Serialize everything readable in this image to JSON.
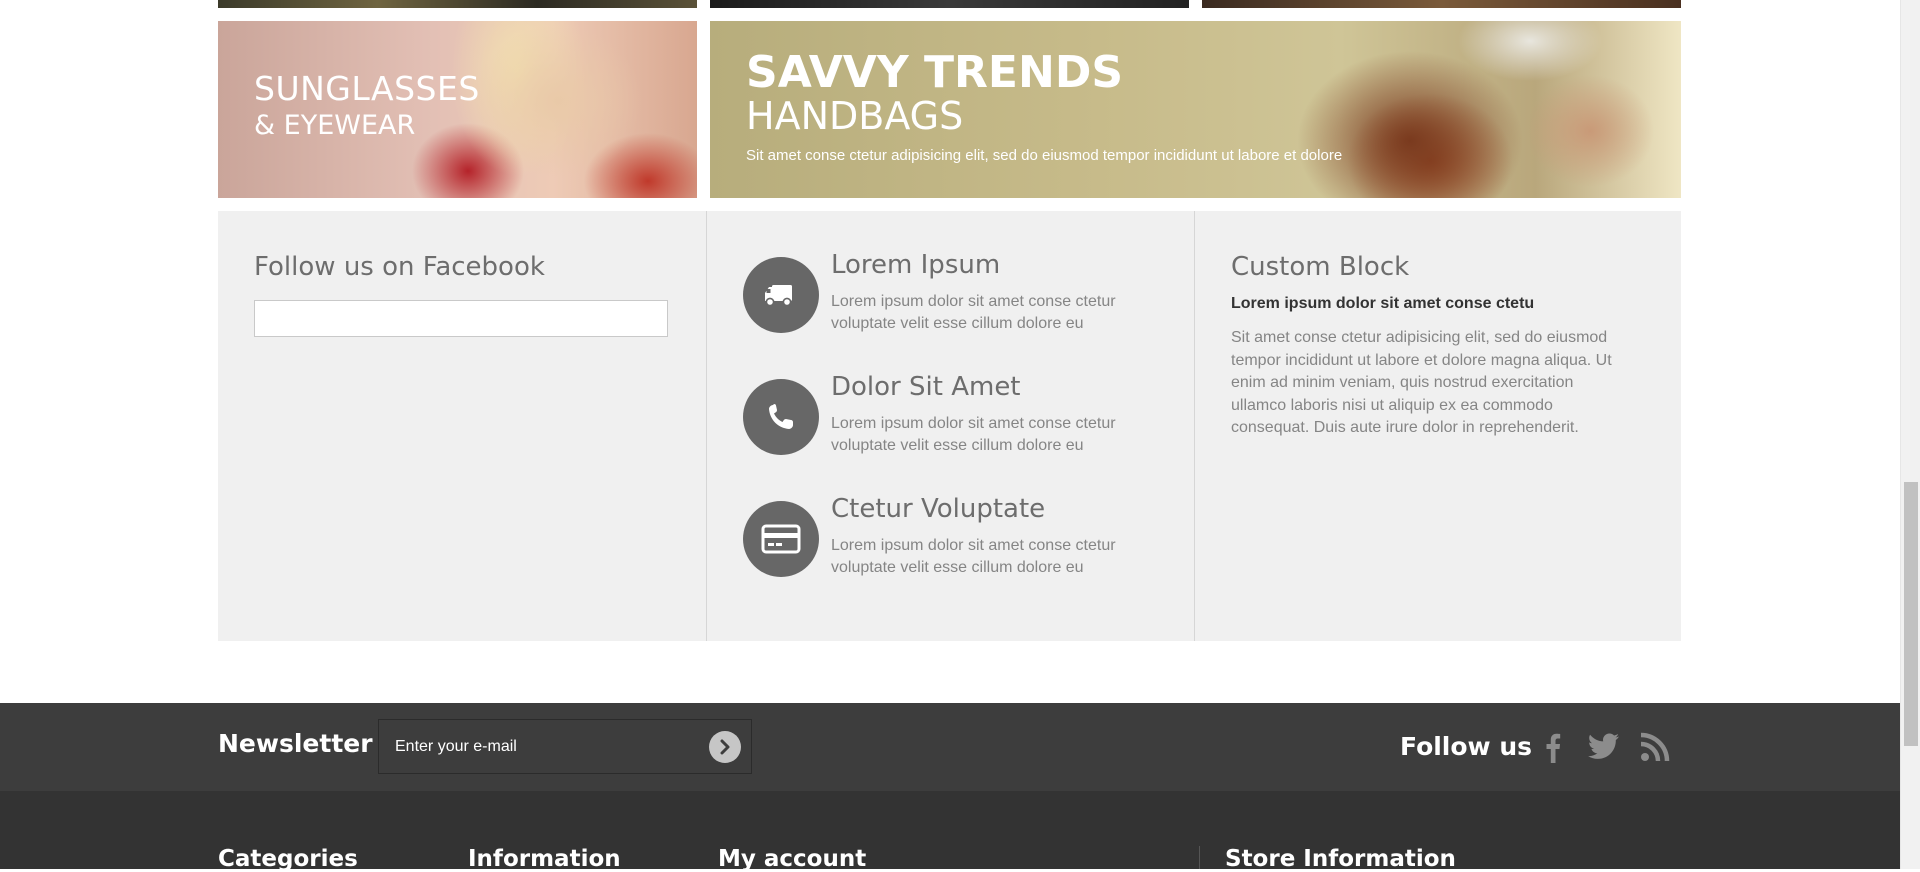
{
  "banners": {
    "sunglasses": {
      "line1": "SUNGLASSES",
      "line2": "& EYEWEAR"
    },
    "handbags": {
      "line1": "SAVVY TRENDS",
      "line2": "HANDBAGS",
      "tagline": "Sit amet conse ctetur adipisicing elit, sed do eiusmod tempor incididunt ut labore et dolore"
    }
  },
  "facebook": {
    "title": "Follow us on Facebook"
  },
  "features": [
    {
      "icon": "truck-icon",
      "title": "Lorem Ipsum",
      "text": "Lorem ipsum dolor sit amet conse ctetur voluptate velit esse cillum dolore eu"
    },
    {
      "icon": "phone-icon",
      "title": "Dolor Sit Amet",
      "text": "Lorem ipsum dolor sit amet conse ctetur voluptate velit esse cillum dolore eu"
    },
    {
      "icon": "credit-card-icon",
      "title": "Ctetur Voluptate",
      "text": "Lorem ipsum dolor sit amet conse ctetur voluptate velit esse cillum dolore eu"
    }
  ],
  "custom_block": {
    "title": "Custom Block",
    "subtitle": "Lorem ipsum dolor sit amet conse ctetu",
    "text": "Sit amet conse ctetur adipisicing elit, sed do eiusmod tempor incididunt ut labore et dolore magna aliqua. Ut enim ad minim veniam, quis nostrud exercitation ullamco laboris nisi ut aliquip ex ea commodo consequat. Duis aute irure dolor in reprehenderit."
  },
  "newsletter": {
    "label": "Newsletter",
    "placeholder": "Enter your e-mail"
  },
  "follow": {
    "label": "Follow us",
    "networks": [
      "facebook-icon",
      "twitter-icon",
      "rss-icon"
    ]
  },
  "footer": {
    "columns": [
      "Categories",
      "Information",
      "My account",
      "Store Information"
    ]
  },
  "colors": {
    "info_bg": "#f0f0f0",
    "icon_circle": "#676767",
    "newsletter_bg": "#3d3d3d",
    "footer_bg": "#333333"
  }
}
